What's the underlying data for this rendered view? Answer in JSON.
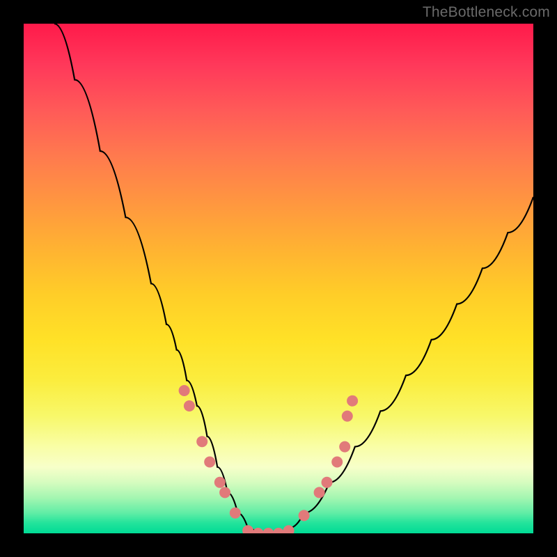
{
  "watermark": "TheBottleneck.com",
  "colors": {
    "frame": "#000000",
    "curve": "#000000",
    "dot_fill": "#e17a7a",
    "dot_stroke": "#c95d5d"
  },
  "chart_data": {
    "type": "line",
    "title": "",
    "xlabel": "",
    "ylabel": "",
    "xlim": [
      0,
      100
    ],
    "ylim": [
      0,
      100
    ],
    "grid": false,
    "note": "Gradient background encodes bottleneck severity (top = high / red, bottom = low / green). Black V-curve shows bottleneck % across some hardware axis; pink dots mark discrete hardware samples near the optimum.",
    "series": [
      {
        "name": "bottleneck-curve",
        "x": [
          6,
          10,
          15,
          20,
          25,
          28,
          30,
          32,
          34,
          36,
          38,
          40,
          42,
          44,
          46,
          48,
          50,
          52,
          55,
          60,
          65,
          70,
          75,
          80,
          85,
          90,
          95,
          100
        ],
        "y": [
          100,
          89,
          75,
          62,
          49,
          41,
          36,
          30,
          25,
          19,
          13,
          8,
          4,
          1,
          0,
          0,
          0,
          1,
          4,
          10,
          17,
          24,
          31,
          38,
          45,
          52,
          59,
          66
        ]
      }
    ],
    "points": [
      {
        "name": "p1",
        "x": 31.5,
        "y": 28
      },
      {
        "name": "p2",
        "x": 32.5,
        "y": 25
      },
      {
        "name": "p3",
        "x": 35.0,
        "y": 18
      },
      {
        "name": "p4",
        "x": 36.5,
        "y": 14
      },
      {
        "name": "p5",
        "x": 38.5,
        "y": 10
      },
      {
        "name": "p6",
        "x": 39.5,
        "y": 8
      },
      {
        "name": "p7",
        "x": 41.5,
        "y": 4
      },
      {
        "name": "p8",
        "x": 44.0,
        "y": 0.5
      },
      {
        "name": "p9",
        "x": 46.0,
        "y": 0
      },
      {
        "name": "p10",
        "x": 48.0,
        "y": 0
      },
      {
        "name": "p11",
        "x": 50.0,
        "y": 0
      },
      {
        "name": "p12",
        "x": 52.0,
        "y": 0.5
      },
      {
        "name": "p13",
        "x": 55.0,
        "y": 3.5
      },
      {
        "name": "p14",
        "x": 58.0,
        "y": 8
      },
      {
        "name": "p15",
        "x": 59.5,
        "y": 10
      },
      {
        "name": "p16",
        "x": 61.5,
        "y": 14
      },
      {
        "name": "p17",
        "x": 63.0,
        "y": 17
      },
      {
        "name": "p18",
        "x": 63.5,
        "y": 23
      },
      {
        "name": "p19",
        "x": 64.5,
        "y": 26
      }
    ]
  }
}
